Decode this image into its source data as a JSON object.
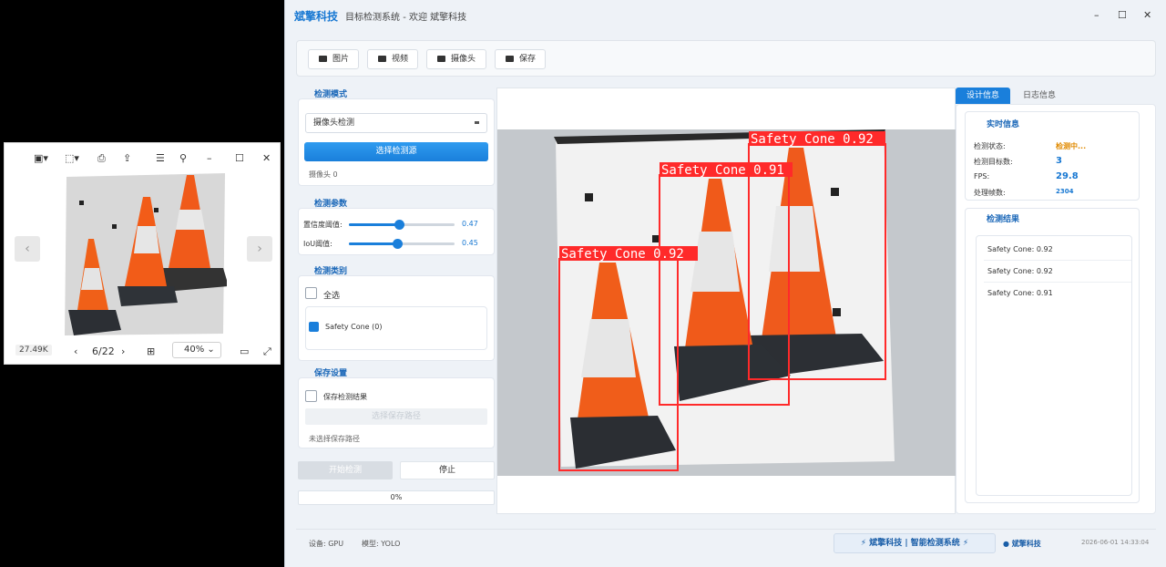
{
  "viewer": {
    "file_size": "27.49K",
    "page_counter": "6/22",
    "zoom": "40%"
  },
  "app": {
    "brand": "斌擎科技",
    "title": "目标检测系统 - 欢迎 斌擎科技",
    "toolbar": {
      "image_label": "图片",
      "video_label": "视频",
      "camera_label": "摄像头",
      "save_label": "保存"
    },
    "detect_mode": {
      "section_title": "检测模式",
      "selected": "摄像头检测",
      "select_source_label": "选择检测源",
      "camera_info": "摄像头 0"
    },
    "params": {
      "section_title": "检测参数",
      "confidence_label": "置信度阈值:",
      "confidence_value": "0.47",
      "confidence": 0.47,
      "iou_label": "IoU阈值:",
      "iou_value": "0.45",
      "iou": 0.45
    },
    "classes": {
      "section_title": "检测类别",
      "select_all_label": "全选",
      "items": [
        {
          "label": "Safety Cone (0)",
          "checked": true
        }
      ]
    },
    "save_settings": {
      "section_title": "保存设置",
      "save_results_label": "保存检测结果",
      "choose_path_label": "选择保存路径",
      "path_status": "未选择保存路径"
    },
    "actions": {
      "start_label": "开始检测",
      "stop_label": "停止"
    },
    "progress": "0%",
    "right": {
      "tab_design": "设计信息",
      "tab_log": "日志信息",
      "realtime": {
        "title": "实时信息",
        "status_label": "检测状态:",
        "status_value": "检测中...",
        "count_label": "检测目标数:",
        "count_value": "3",
        "fps_label": "FPS:",
        "fps_value": "29.8",
        "frames_label": "处理帧数:",
        "frames_value": "2304"
      },
      "results": {
        "title": "检测结果",
        "items": [
          "Safety Cone: 0.92",
          "Safety Cone: 0.92",
          "Safety Cone: 0.91"
        ]
      }
    },
    "detections": [
      {
        "label": "Safety Cone 0.92"
      },
      {
        "label": "Safety Cone 0.91"
      },
      {
        "label": "Safety Cone 0.92"
      }
    ],
    "footer": {
      "device": "设备: GPU",
      "model": "模型: YOLO",
      "badge": "斌擎科技 | 智能检测系统",
      "user": "斌擎科技",
      "datetime": "2026-06-01 14:33:04"
    },
    "colors": {
      "accent": "#1a7fdb",
      "box": "#ff2a2a",
      "status": "#e08a00"
    }
  }
}
